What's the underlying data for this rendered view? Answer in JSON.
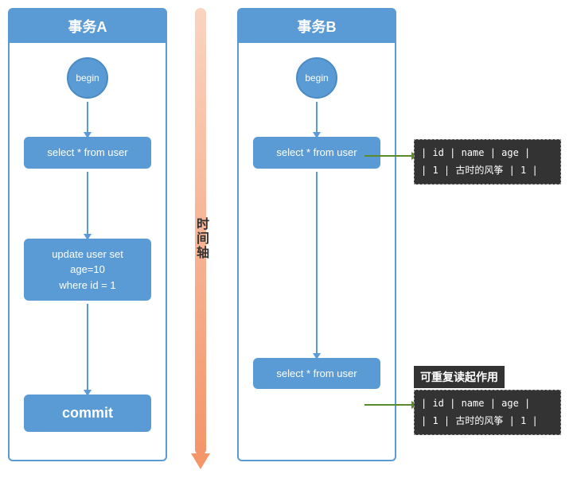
{
  "transactionA": {
    "header": "事务A",
    "begin": "begin",
    "sql1": "select * from user",
    "sql2": "update user set age=10\nwhere id = 1",
    "commit": "commit"
  },
  "transactionB": {
    "header": "事务B",
    "begin": "begin",
    "sql1": "select * from user",
    "sql2": "select * from user"
  },
  "timeAxis": {
    "label": "时间轴"
  },
  "table1": {
    "header": "| id | name       | age |",
    "row1": "| 1  | 古时的风筝  | 1   |"
  },
  "table2": {
    "label": "可重复读起作用",
    "header": "| id | name       | age |",
    "row1": "| 1  | 古时的风筝  | 1   |"
  }
}
